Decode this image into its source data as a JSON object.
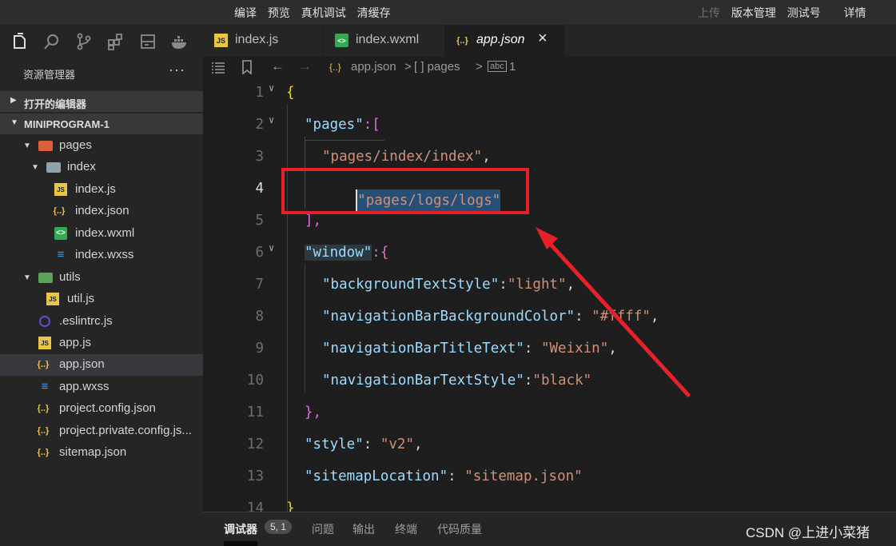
{
  "topbar": {
    "left_items": [
      "编译",
      "预览",
      "真机调试",
      "清缓存"
    ],
    "right_items": [
      "上传",
      "版本管理",
      "测试号",
      "详情"
    ]
  },
  "sidebar": {
    "header": "资源管理器",
    "more": "···",
    "sections": {
      "open_editors": "打开的编辑器",
      "project": "MINIPROGRAM-1"
    },
    "items": [
      {
        "label": "pages"
      },
      {
        "label": "index"
      },
      {
        "label": "index.js"
      },
      {
        "label": "index.json"
      },
      {
        "label": "index.wxml"
      },
      {
        "label": "index.wxss"
      },
      {
        "label": "utils"
      },
      {
        "label": "util.js"
      },
      {
        "label": ".eslintrc.js"
      },
      {
        "label": "app.js"
      },
      {
        "label": "app.json"
      },
      {
        "label": "app.wxss"
      },
      {
        "label": "project.config.json"
      },
      {
        "label": "project.private.config.js..."
      },
      {
        "label": "sitemap.json"
      }
    ]
  },
  "tabs": [
    {
      "label": "index.js"
    },
    {
      "label": "index.wxml"
    },
    {
      "label": "app.json"
    }
  ],
  "breadcrumb": {
    "file": "app.json",
    "sep": ">",
    "array": "[ ] pages",
    "index": "1"
  },
  "editor": {
    "line_numbers": [
      "1",
      "2",
      "3",
      "4",
      "5",
      "6",
      "7",
      "8",
      "9",
      "10",
      "11",
      "12",
      "13",
      "14"
    ],
    "lines": {
      "l1": "{",
      "l2_key": "\"pages\"",
      "l2_rest": ":[",
      "l3": "\"pages/index/index\"",
      "l3_comma": ",",
      "l4": "\"pages/logs/logs\"",
      "l5": "],",
      "l6_key": "\"window\"",
      "l6_rest": ":{",
      "l7_key": "\"backgroundTextStyle\"",
      "l7_val": "\"light\"",
      "l8_key": "\"navigationBarBackgroundColor\"",
      "l8_val": "\"#ffff\"",
      "l9_key": "\"navigationBarTitleText\"",
      "l9_val": "\"Weixin\"",
      "l10_key": "\"navigationBarTextStyle\"",
      "l10_val": "\"black\"",
      "l11": "},",
      "l12_key": "\"style\"",
      "l12_val": "\"v2\"",
      "l13_key": "\"sitemapLocation\"",
      "l13_val": "\"sitemap.json\"",
      "l14": "}"
    }
  },
  "panel": {
    "tabs": [
      "调试器",
      "问题",
      "输出",
      "终端",
      "代码质量"
    ],
    "cursor_badge": "5, 1"
  },
  "watermark": "CSDN @上进小菜猪",
  "colors": {
    "annotation": "#e8202a",
    "selection": "#264f78"
  }
}
